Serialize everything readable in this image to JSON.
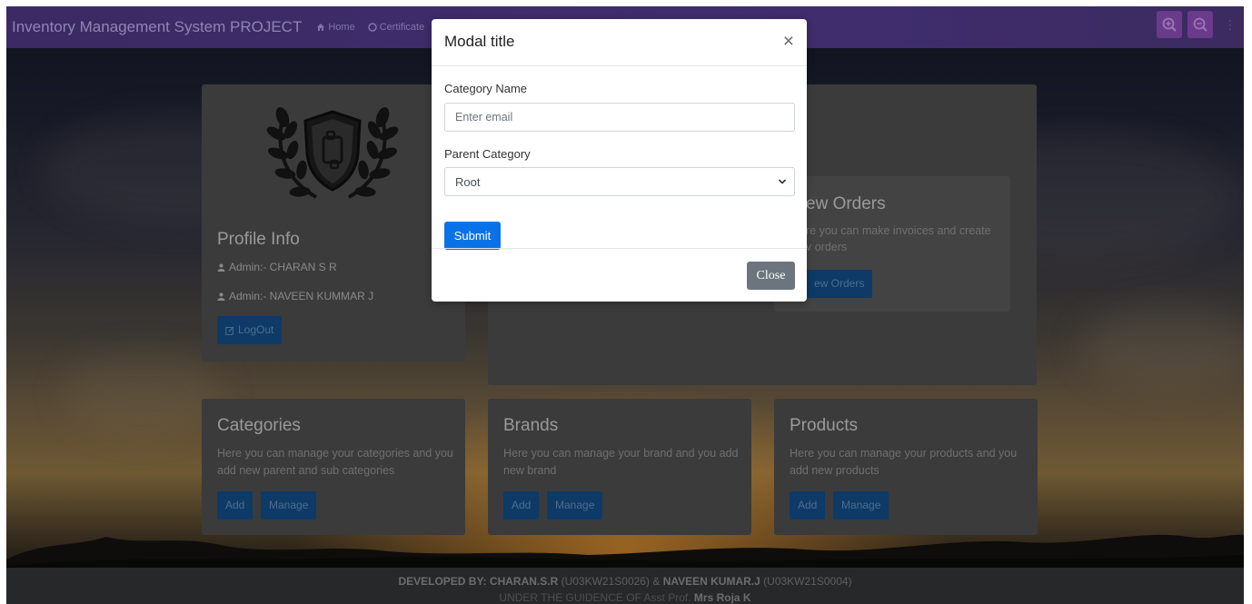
{
  "navbar": {
    "brand": "Inventory Management System PROJECT",
    "links": [
      {
        "label": "Home",
        "icon": "home-icon"
      },
      {
        "label": "Certificate",
        "icon": "certificate-icon"
      }
    ],
    "zoom_in_icon": "zoom-in-icon",
    "zoom_out_icon": "zoom-out-icon"
  },
  "profile": {
    "title": "Profile Info",
    "admins": [
      "Admin:- CHARAN S R",
      "Admin:- NAVEEN KUMMAR J"
    ],
    "logout_label": "LogOut"
  },
  "orders": {
    "title_partial": "ew Orders",
    "text_partial": "re you can make invoices and create",
    "text_partial_2": "v orders",
    "button_partial": "ew Orders"
  },
  "cards": [
    {
      "title": "Categories",
      "text": "Here you can manage your categories and you add new parent and sub categories",
      "add_label": "Add",
      "manage_label": "Manage"
    },
    {
      "title": "Brands",
      "text": "Here you can manage your brand and you add new brand",
      "add_label": "Add",
      "manage_label": "Manage"
    },
    {
      "title": "Products",
      "text": "Here you can manage your products and you add new products",
      "add_label": "Add",
      "manage_label": "Manage"
    }
  ],
  "modal": {
    "title": "Modal title",
    "close_symbol": "×",
    "category_label": "Category Name",
    "category_placeholder": "Enter email",
    "parent_label": "Parent Category",
    "parent_selected": "Root",
    "submit_label": "Submit",
    "close_label": "Close"
  },
  "footer": {
    "developed_by": "DEVELOPED BY:",
    "dev1": "CHARAN.S.R",
    "dev1_id": "(U03KW21S0026)",
    "and": "&",
    "dev2": "NAVEEN KUMAR.J",
    "dev2_id": "(U03KW21S0004)",
    "guidance": "UNDER THE GUIDENCE OF Asst Prof.",
    "guide": "Mrs Roja K"
  },
  "colors": {
    "navbar": "#3e2c6b",
    "submit": "#0a72e8",
    "close": "#6c757d",
    "card": "#3b3b3b",
    "footer": "#272829"
  }
}
